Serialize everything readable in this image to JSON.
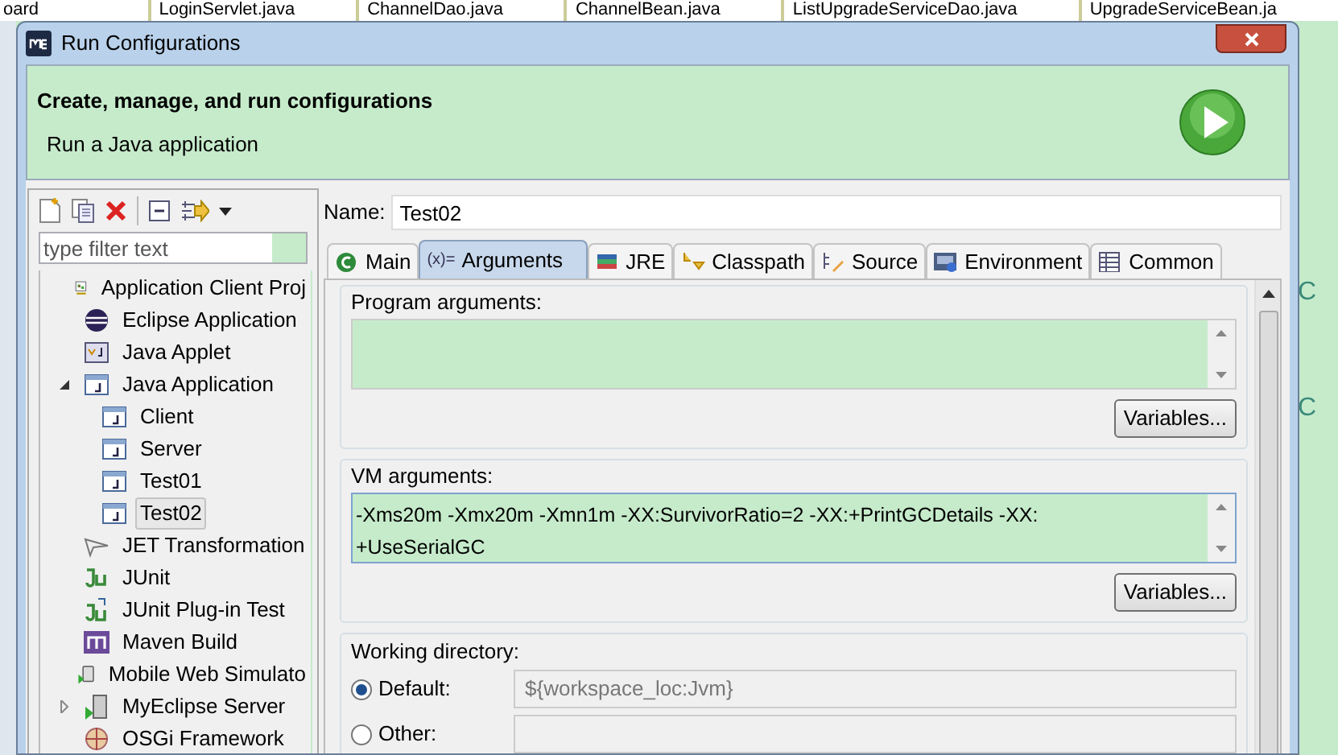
{
  "background": {
    "editor_tabs": [
      "oard",
      "LoginServlet.java",
      "ChannelDao.java",
      "ChannelBean.java",
      "ListUpgradeServiceDao.java",
      "UpgradeServiceBean.ja"
    ],
    "editor_marks": [
      "C",
      "C"
    ]
  },
  "window": {
    "title": "Run Configurations"
  },
  "header": {
    "title": "Create, manage, and run configurations",
    "message": "Run a Java application"
  },
  "sidebar": {
    "filter": {
      "placeholder": "type filter text"
    },
    "items": [
      {
        "label": "Application Client Proj",
        "kind": "appclient"
      },
      {
        "label": "Eclipse Application",
        "kind": "eclipse"
      },
      {
        "label": "Java Applet",
        "kind": "applet"
      },
      {
        "label": "Java Application",
        "kind": "java",
        "expanded": true,
        "children": [
          {
            "label": "Client",
            "kind": "java",
            "selected": false
          },
          {
            "label": "Server",
            "kind": "java",
            "selected": false
          },
          {
            "label": "Test01",
            "kind": "java",
            "selected": false
          },
          {
            "label": "Test02",
            "kind": "java",
            "selected": true
          }
        ]
      },
      {
        "label": "JET Transformation",
        "kind": "jet"
      },
      {
        "label": "JUnit",
        "kind": "junit"
      },
      {
        "label": "JUnit Plug-in Test",
        "kind": "junitplugin"
      },
      {
        "label": "Maven Build",
        "kind": "maven"
      },
      {
        "label": "Mobile Web Simulato",
        "kind": "mobile"
      },
      {
        "label": "MyEclipse Server",
        "kind": "server",
        "expanded": false
      },
      {
        "label": "OSGi Framework",
        "kind": "osgi"
      }
    ]
  },
  "name_field": {
    "label": "Name:",
    "value": "Test02"
  },
  "tabs": [
    {
      "label": "Main",
      "kind": "main",
      "selected": false
    },
    {
      "label": "Arguments",
      "kind": "args",
      "icon_text": "(x)=",
      "selected": true
    },
    {
      "label": "JRE",
      "kind": "jre",
      "selected": false
    },
    {
      "label": "Classpath",
      "kind": "classpath",
      "selected": false
    },
    {
      "label": "Source",
      "kind": "source",
      "selected": false
    },
    {
      "label": "Environment",
      "kind": "env",
      "selected": false
    },
    {
      "label": "Common",
      "kind": "common",
      "selected": false
    }
  ],
  "program_arguments": {
    "label": "Program arguments:",
    "button": "Variables..."
  },
  "vm_arguments": {
    "label": "VM arguments:",
    "value": "-Xms20m -Xmx20m -Xmn1m -XX:SurvivorRatio=2 -XX:+PrintGCDetails -XX:\n+UseSerialGC",
    "button": "Variables..."
  },
  "working_directory": {
    "label": "Working directory:",
    "options": [
      {
        "label": "Default:",
        "selected": true,
        "value": "${workspace_loc:Jvm}",
        "disabled": true
      },
      {
        "label": "Other:",
        "selected": false,
        "disabled": true
      }
    ]
  }
}
